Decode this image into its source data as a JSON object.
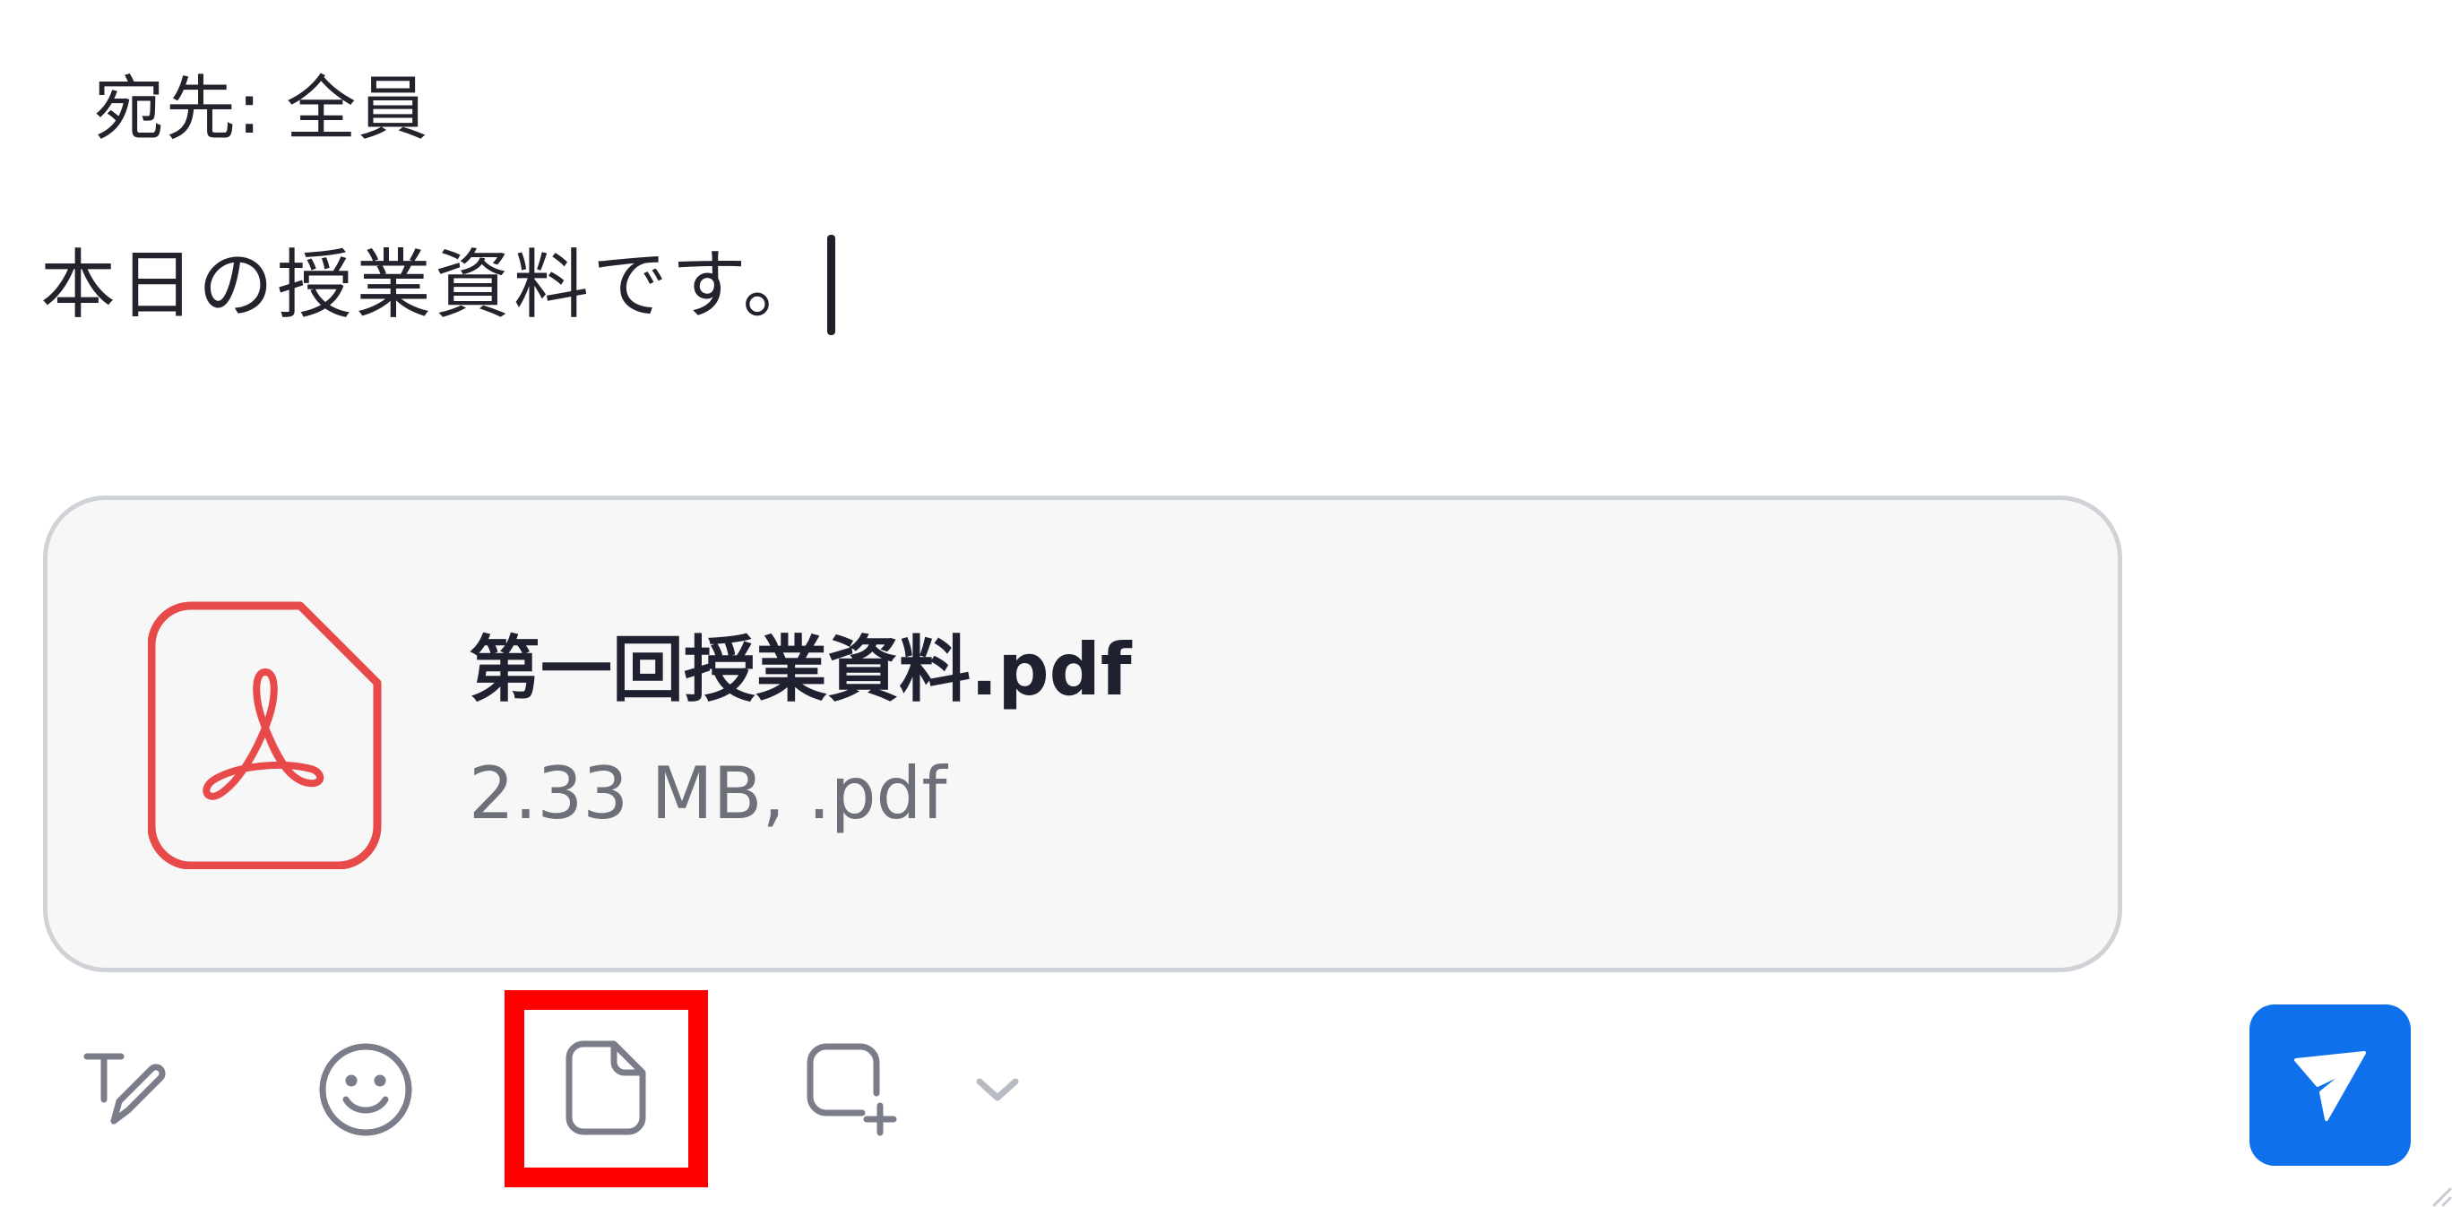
{
  "recipient": {
    "label": "宛先:",
    "value": "全員"
  },
  "message": {
    "text": "本日の授業資料です。"
  },
  "attachment": {
    "file_name": "第一回授業資料.pdf",
    "file_meta": "2.33 MB, .pdf",
    "icon": "pdf-file-icon",
    "icon_color": "#e84a4a"
  },
  "toolbar": {
    "items": [
      {
        "name": "text-format",
        "icon": "text-format-pen-icon"
      },
      {
        "name": "emoji",
        "icon": "smiley-icon"
      },
      {
        "name": "attach-file",
        "icon": "file-icon",
        "highlighted": true
      },
      {
        "name": "screenshot",
        "icon": "square-plus-icon"
      },
      {
        "name": "more-options",
        "icon": "chevron-down-icon"
      }
    ],
    "send": {
      "icon": "send-arrow-icon",
      "color": "#0e71eb"
    },
    "highlight_color": "#ff0000"
  }
}
